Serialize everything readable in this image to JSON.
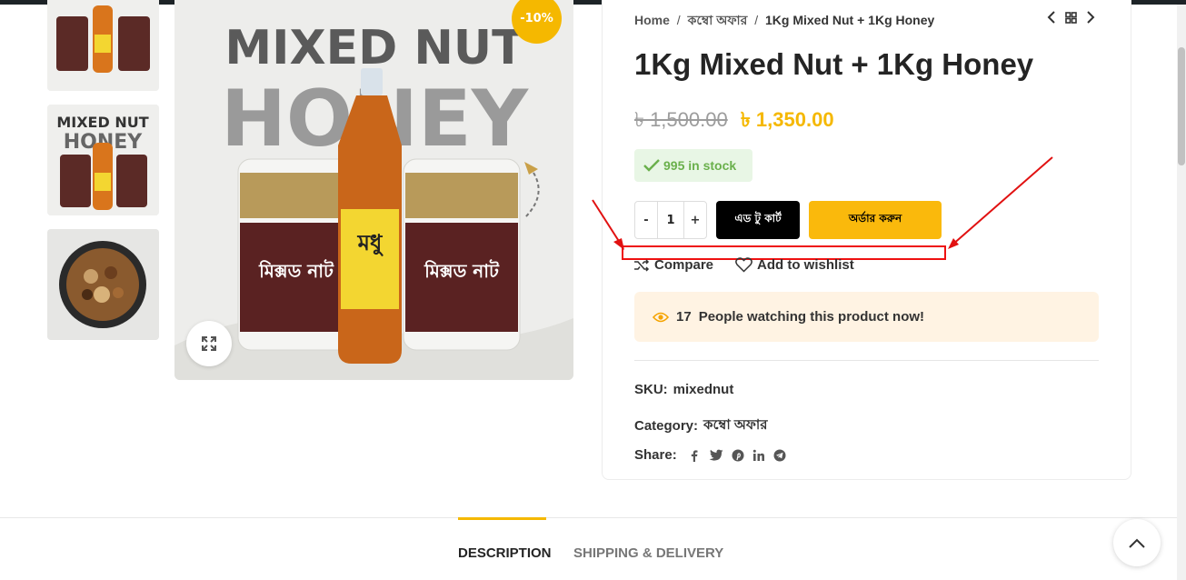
{
  "breadcrumb": {
    "home": "Home",
    "category": "কম্বো অফার",
    "current": "1Kg Mixed Nut + 1Kg Honey"
  },
  "product": {
    "title": "1Kg Mixed Nut + 1Kg Honey",
    "price_old": "৳ 1,500.00",
    "price_new": "৳ 1,350.00",
    "sale_badge": "-10%",
    "stock": "995 in stock",
    "quantity": "1",
    "qty_minus": "-",
    "qty_plus": "+",
    "add_to_cart": "এড টু কার্ট",
    "order_now": "অর্ডার করুন",
    "compare": "Compare",
    "wishlist": "Add to wishlist",
    "watching_count": "17",
    "watching_text": "People watching this product now!",
    "sku_label": "SKU:",
    "sku_value": "mixednut",
    "category_label": "Category:",
    "category_value": "কম্বো অফার",
    "share_label": "Share:"
  },
  "image": {
    "headline_1": "MIXED NUT",
    "headline_2": "HONEY",
    "jar_label": "মিক্সড নাট",
    "bottle_label": "মধু"
  },
  "tabs": {
    "description": "DESCRIPTION",
    "shipping": "SHIPPING & DELIVERY"
  },
  "colors": {
    "accent": "#f5b800",
    "annotation": "#e11111",
    "stock_green": "#6ab04c"
  }
}
